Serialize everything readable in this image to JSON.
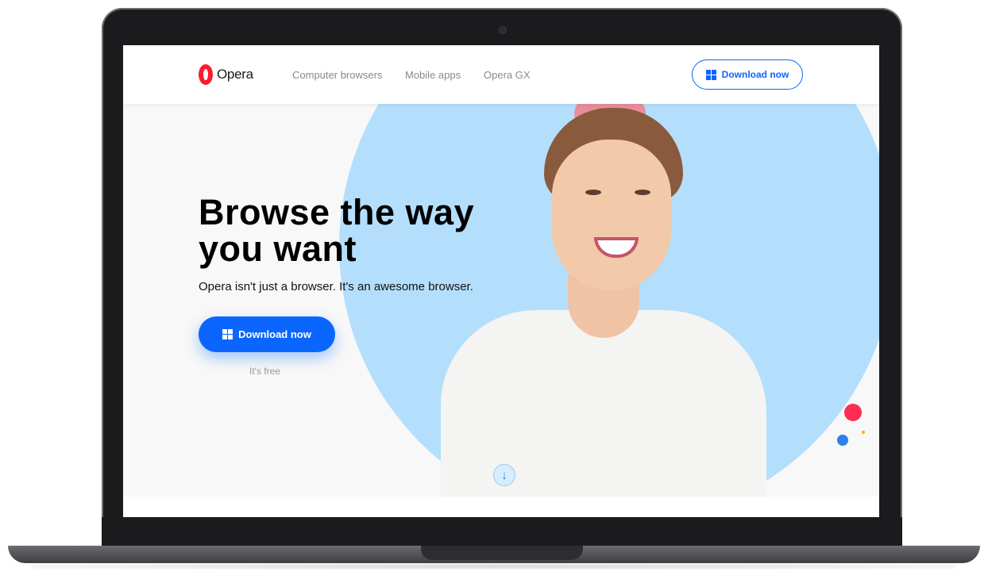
{
  "nav": {
    "logo_text": "Opera",
    "links": [
      "Computer browsers",
      "Mobile apps",
      "Opera GX"
    ],
    "download_label": "Download now"
  },
  "hero": {
    "headline": "Browse the way you want",
    "subheadline": "Opera isn't just a browser. It's an awesome browser.",
    "download_label": "Download now",
    "note": "It's free",
    "scroll_icon": "↓"
  },
  "colors": {
    "brand_red": "#ff1b2d",
    "accent_blue": "#0a66ff",
    "circle_blue": "#b4dffc",
    "dot_red": "#ff2d55",
    "dot_blue": "#2f80ed",
    "dot_yellow": "#ffb400"
  },
  "icons": [
    "opera-logo-icon",
    "windows-icon",
    "arrow-down-icon"
  ]
}
